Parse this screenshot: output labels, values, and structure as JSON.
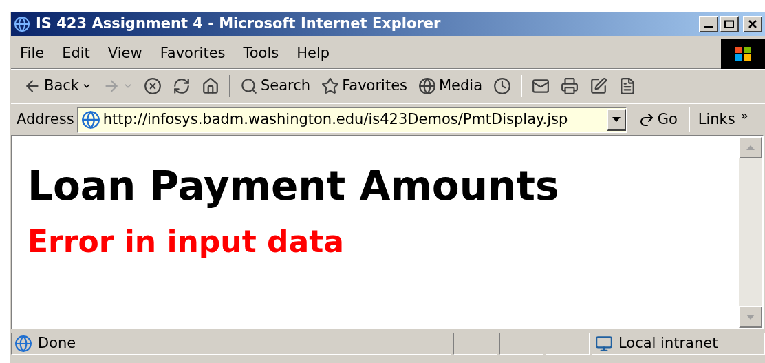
{
  "window": {
    "title": "IS 423 Assignment 4 - Microsoft Internet Explorer"
  },
  "menu": [
    "File",
    "Edit",
    "View",
    "Favorites",
    "Tools",
    "Help"
  ],
  "toolbar": [
    {
      "kind": "back",
      "label": "Back",
      "disabled": false
    },
    {
      "kind": "forward",
      "disabled": true
    },
    {
      "kind": "stop"
    },
    {
      "kind": "refresh"
    },
    {
      "kind": "home"
    },
    {
      "kind": "separator"
    },
    {
      "kind": "search",
      "label": "Search"
    },
    {
      "kind": "favorites",
      "label": "Favorites"
    },
    {
      "kind": "media",
      "label": "Media"
    },
    {
      "kind": "history"
    },
    {
      "kind": "separator"
    },
    {
      "kind": "mail"
    },
    {
      "kind": "print"
    },
    {
      "kind": "edit"
    },
    {
      "kind": "discuss"
    }
  ],
  "address": {
    "label": "Address",
    "value": "http://infosys.badm.washington.edu/is423Demos/PmtDisplay.jsp",
    "go": "Go"
  },
  "links": {
    "label": "Links",
    "chevron": "»"
  },
  "page": {
    "heading": "Loan Payment Amounts",
    "error": "Error in input data"
  },
  "status_bar": {
    "text": "Done",
    "zone": "Local intranet"
  }
}
